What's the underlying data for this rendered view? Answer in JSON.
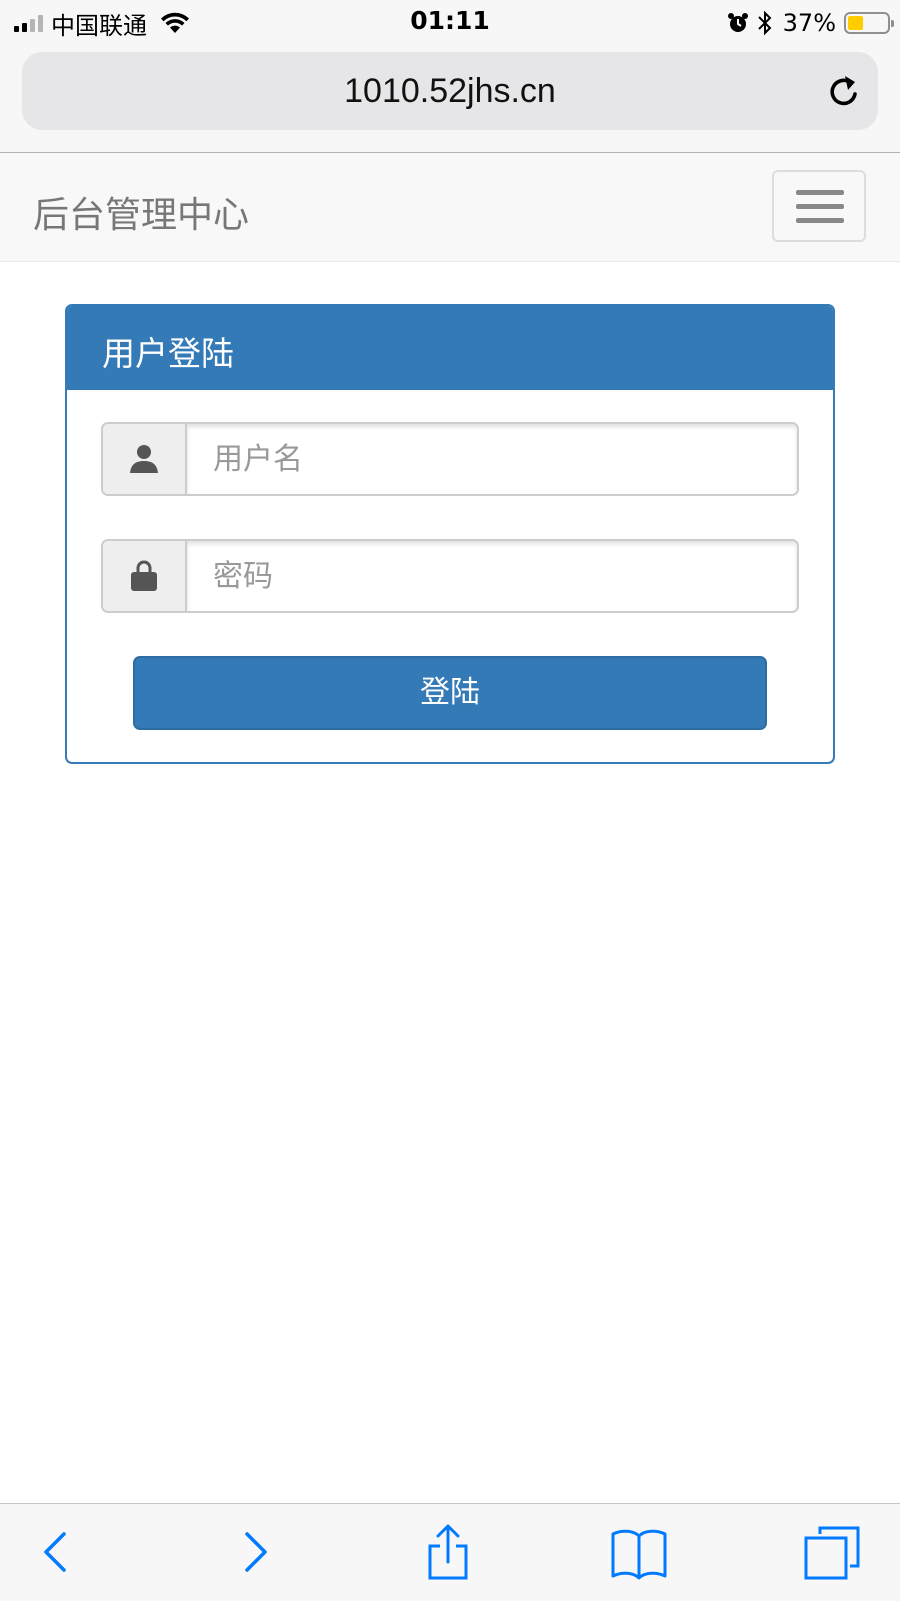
{
  "status_bar": {
    "carrier": "中国联通",
    "time": "01:11",
    "battery_percent": "37%",
    "battery_level": 0.37,
    "icons": [
      "signal-icon",
      "wifi-icon",
      "alarm-icon",
      "bluetooth-icon",
      "battery-icon"
    ]
  },
  "browser": {
    "url": "1010.52jhs.cn",
    "toolbar_icons": [
      "back-icon",
      "forward-icon",
      "share-icon",
      "bookmarks-icon",
      "tabs-icon"
    ]
  },
  "navbar": {
    "brand": "后台管理中心",
    "toggle_icon": "hamburger-icon"
  },
  "login_panel": {
    "title": "用户登陆",
    "username": {
      "placeholder": "用户名",
      "value": "",
      "icon": "user-icon"
    },
    "password": {
      "placeholder": "密码",
      "value": "",
      "icon": "lock-icon"
    },
    "submit_label": "登陆"
  },
  "colors": {
    "primary": "#337ab7",
    "ios_blue": "#007aff",
    "navbar_bg": "#f8f8f8",
    "brand_text": "#777777"
  }
}
